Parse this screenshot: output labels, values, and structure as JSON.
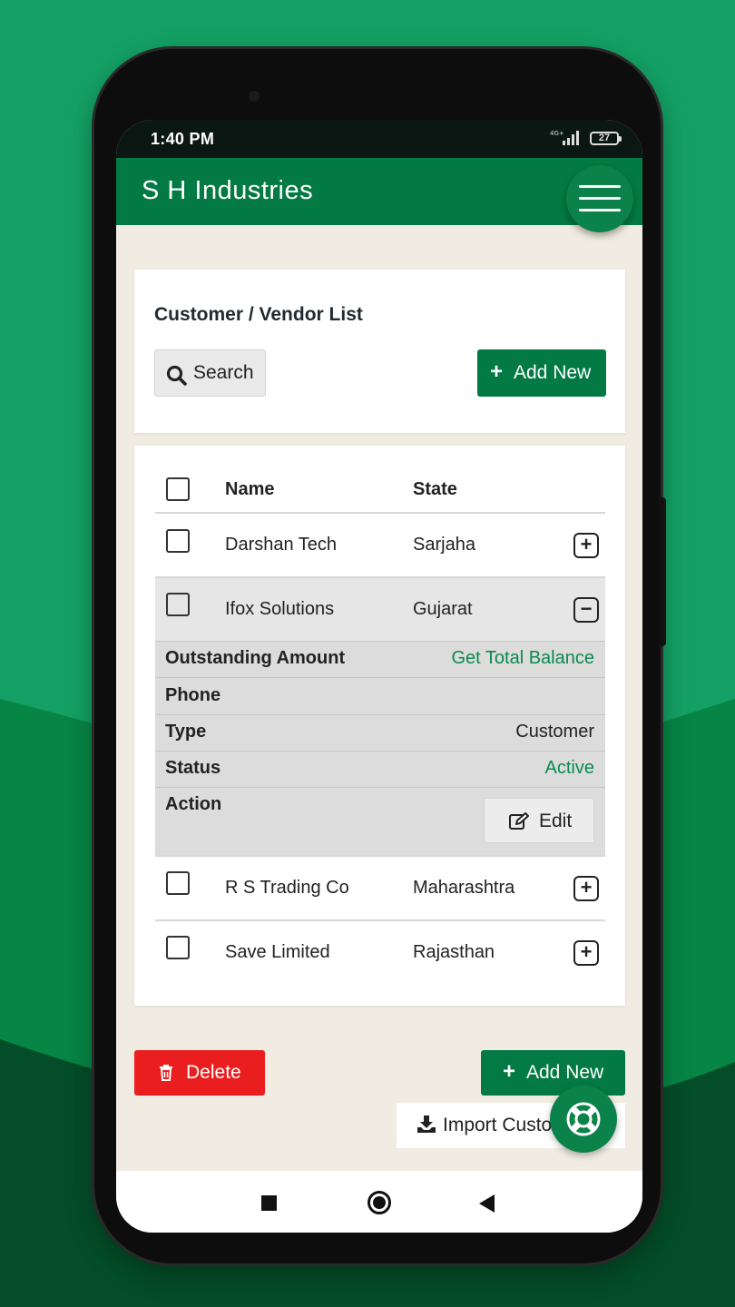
{
  "status_bar": {
    "time": "1:40 PM",
    "network": "4G+",
    "battery": "27"
  },
  "app": {
    "title": "S H Industries"
  },
  "header_card": {
    "title": "Customer / Vendor List",
    "search_label": "Search",
    "add_new_label": "Add New"
  },
  "table": {
    "columns": [
      "Name",
      "State"
    ],
    "rows": [
      {
        "name": "Darshan Tech",
        "state": "Sarjaha",
        "expand": "+"
      },
      {
        "name": "Ifox Solutions",
        "state": "Gujarat",
        "expand": "−"
      },
      {
        "name": "R S Trading Co",
        "state": "Maharashtra",
        "expand": "+"
      },
      {
        "name": "Save Limited",
        "state": "Rajasthan",
        "expand": "+"
      }
    ],
    "detail": {
      "outstanding_label": "Outstanding Amount",
      "outstanding_value": "Get Total Balance",
      "phone_label": "Phone",
      "phone_value": "",
      "type_label": "Type",
      "type_value": "Customer",
      "status_label": "Status",
      "status_value": "Active",
      "action_label": "Action",
      "edit_label": "Edit"
    }
  },
  "footer": {
    "delete_label": "Delete",
    "add_new_label": "Add New",
    "import_label": "Import Customers"
  },
  "colors": {
    "primary": "#037a43",
    "background_green": "#14a064",
    "danger": "#ea1e1e",
    "screen_background": "#f1ece2"
  }
}
